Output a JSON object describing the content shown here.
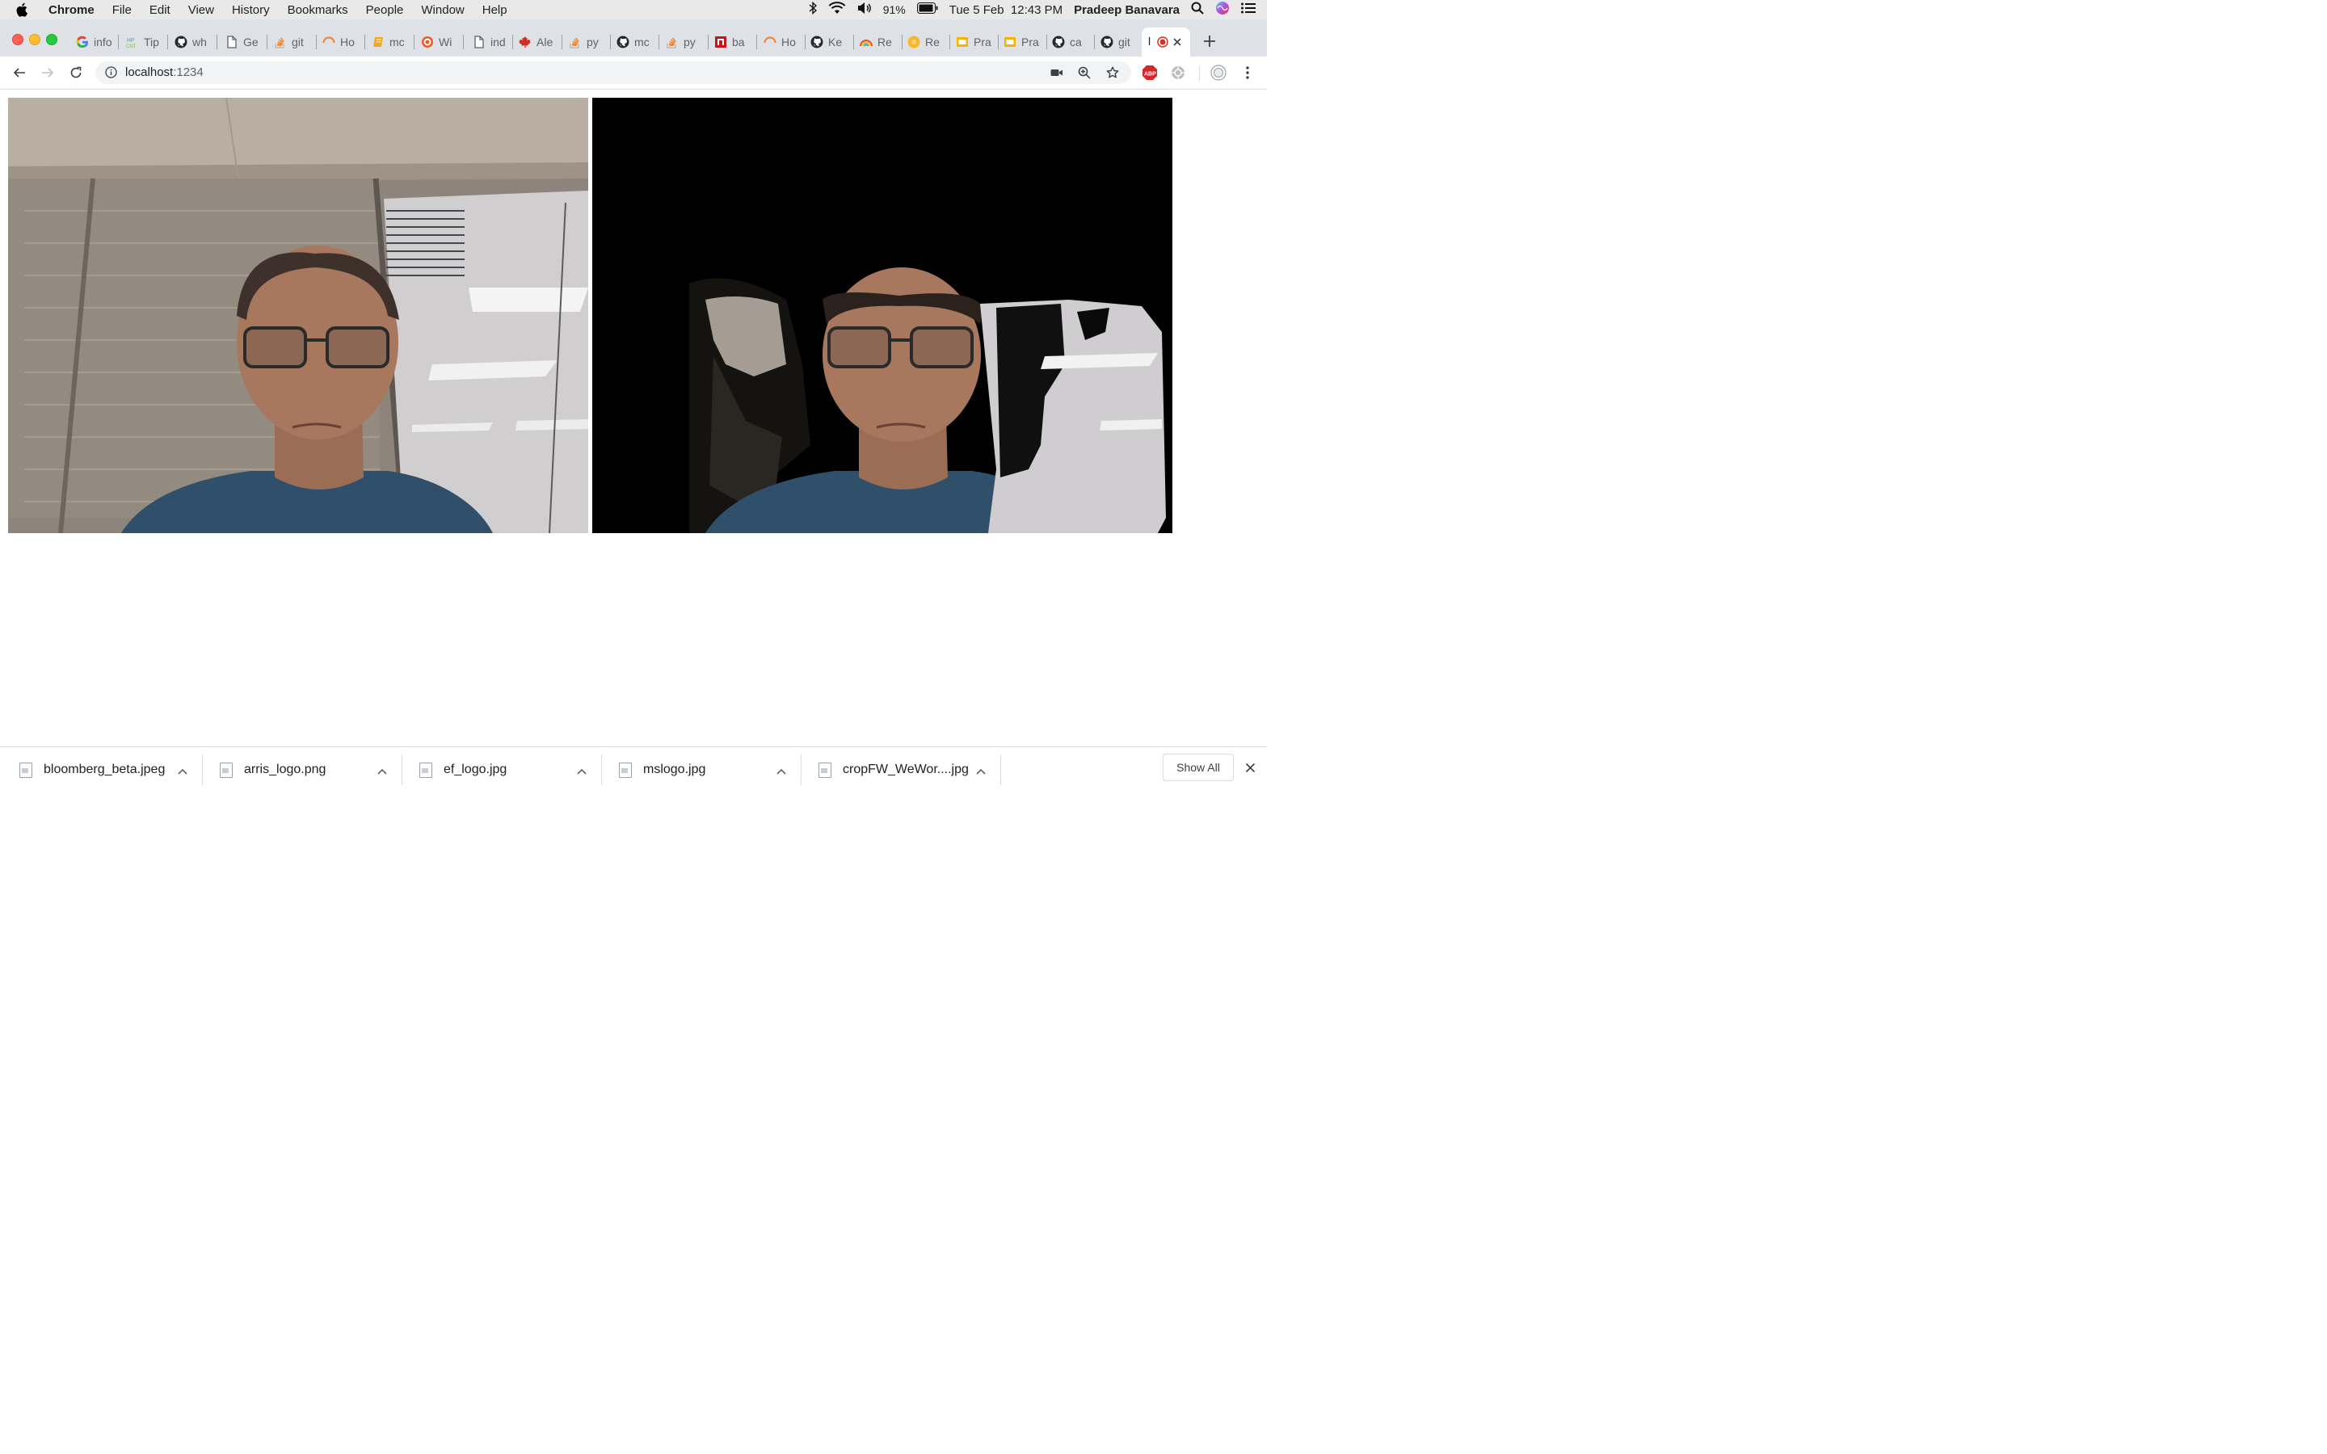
{
  "menubar": {
    "app": "Chrome",
    "items": [
      "File",
      "Edit",
      "View",
      "History",
      "Bookmarks",
      "People",
      "Window",
      "Help"
    ],
    "battery": "91%",
    "datetime": "Tue 5 Feb  12:43 PM",
    "user": "Pradeep Banavara"
  },
  "tabs": [
    {
      "label": "info",
      "icon": "google-icon"
    },
    {
      "label": "Tip",
      "icon": "hp-icon"
    },
    {
      "label": "wh",
      "icon": "github-icon"
    },
    {
      "label": "Ge",
      "icon": "page-icon"
    },
    {
      "label": "git",
      "icon": "stackoverflow-icon"
    },
    {
      "label": "Ho",
      "icon": "orange-arc-icon"
    },
    {
      "label": "mc",
      "icon": "book-icon"
    },
    {
      "label": "Wi",
      "icon": "target-icon"
    },
    {
      "label": "ind",
      "icon": "page-icon"
    },
    {
      "label": "Ale",
      "icon": "maple-leaf-icon"
    },
    {
      "label": "py",
      "icon": "stackoverflow-icon"
    },
    {
      "label": "mc",
      "icon": "github-icon"
    },
    {
      "label": "py",
      "icon": "stackoverflow-icon"
    },
    {
      "label": "ba",
      "icon": "red-square-icon"
    },
    {
      "label": "Ho",
      "icon": "orange-arc-icon"
    },
    {
      "label": "Ke",
      "icon": "github-icon"
    },
    {
      "label": "Re",
      "icon": "rainbow-icon"
    },
    {
      "label": "Re",
      "icon": "sun-icon"
    },
    {
      "label": "Pra",
      "icon": "slides-icon"
    },
    {
      "label": "Pra",
      "icon": "slides-icon"
    },
    {
      "label": "ca",
      "icon": "github-icon"
    },
    {
      "label": "git",
      "icon": "github-icon"
    }
  ],
  "active_tab": {
    "label": "l"
  },
  "address": {
    "host": "localhost",
    "port": ":1234"
  },
  "downloads": [
    {
      "name": "bloomberg_beta.jpeg"
    },
    {
      "name": "arris_logo.png"
    },
    {
      "name": "ef_logo.jpg"
    },
    {
      "name": "mslogo.jpg"
    },
    {
      "name": "cropFW_WeWor....jpg"
    }
  ],
  "show_all": "Show All",
  "colors": {
    "tabstrip": "#dee1e6",
    "active_tab": "#ffffff",
    "omnibox": "#f1f3f4",
    "abp_red": "#d7262b"
  }
}
